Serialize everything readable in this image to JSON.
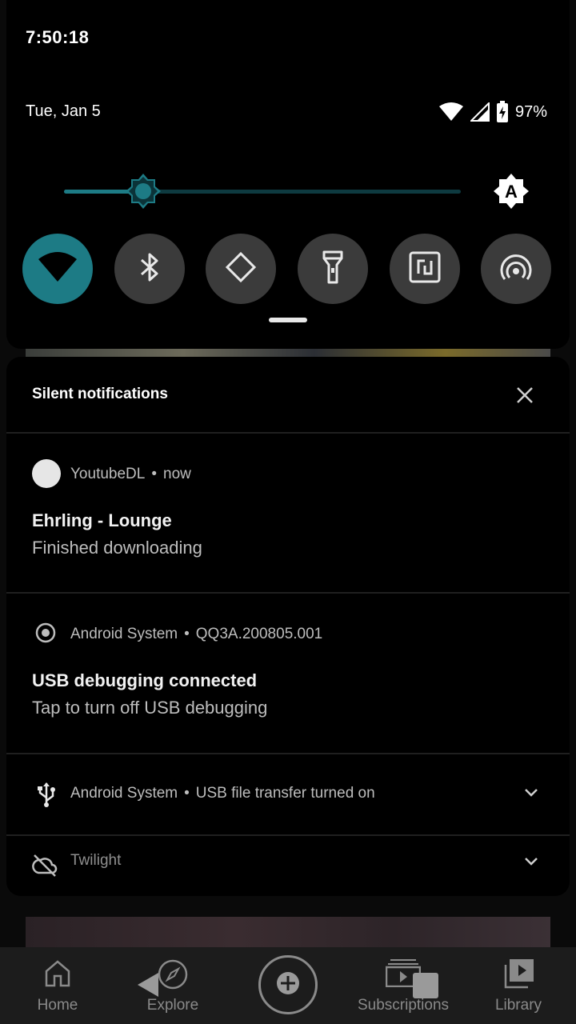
{
  "status_bar": {
    "time": "7:50:18",
    "date": "Tue, Jan 5",
    "battery_percent": "97%",
    "battery_level": 0.97
  },
  "quick_settings": {
    "brightness_level": 0.2,
    "auto_brightness_label": "A",
    "tiles": [
      {
        "name": "wifi",
        "icon": "wifi-icon",
        "active": true
      },
      {
        "name": "bluetooth",
        "icon": "bluetooth-icon",
        "active": false
      },
      {
        "name": "auto-rotate",
        "icon": "auto-rotate-icon",
        "active": false
      },
      {
        "name": "flashlight",
        "icon": "flashlight-icon",
        "active": false
      },
      {
        "name": "nfc",
        "icon": "nfc-icon",
        "active": false
      },
      {
        "name": "hotspot",
        "icon": "hotspot-icon",
        "active": false
      }
    ],
    "accent_color": "#1d7b85"
  },
  "notifications": {
    "section_title": "Silent notifications",
    "items": [
      {
        "app": "YoutubeDL",
        "separator": "•",
        "time": "now",
        "title": "Ehrling - Lounge",
        "text": "Finished downloading"
      },
      {
        "app": "Android System",
        "separator": "•",
        "subtext": "QQ3A.200805.001",
        "title": "USB debugging connected",
        "text": "Tap to turn off USB debugging"
      },
      {
        "app": "Android System",
        "separator": "•",
        "subtext": "USB file transfer turned on"
      },
      {
        "app": "Twilight"
      }
    ]
  },
  "bottom_nav": {
    "items": [
      "Home",
      "Explore",
      "Subscriptions",
      "Library"
    ]
  }
}
